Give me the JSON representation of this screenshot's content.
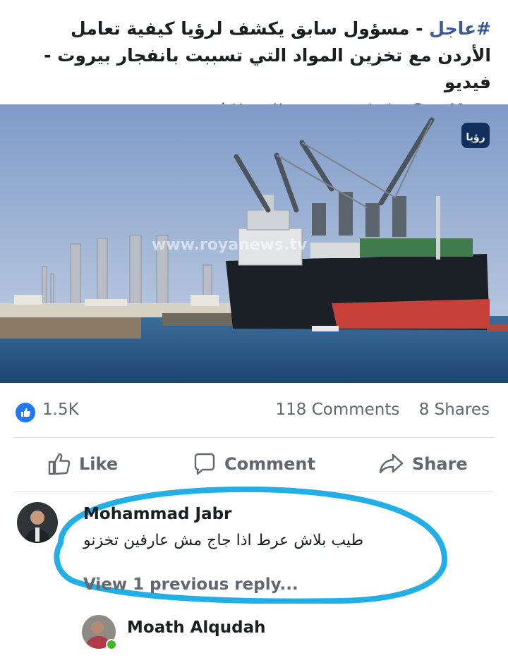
{
  "post": {
    "hashtag": "#عاجل",
    "headline_rest": " - مسؤول سابق يكشف لرؤيا كيفية تعامل الأردن مع تخزين المواد التي تسببت بانفجار بيروت - فيديو",
    "link_text": "https://royanews.tv/...",
    "see_more": "See More"
  },
  "media": {
    "watermark": "www.royanews.tv",
    "logo_text": "رؤيا"
  },
  "stats": {
    "likes": "1.5K",
    "comments": "118 Comments",
    "shares": "8 Shares"
  },
  "actions": {
    "like": "Like",
    "comment": "Comment",
    "share": "Share"
  },
  "comments": [
    {
      "author": "Mohammad Jabr",
      "text": "طيب بلاش عرط اذا جاج مش عارفين تخزنو",
      "reply_link": "View 1 previous reply..."
    },
    {
      "author": "Moath Alqudah"
    }
  ],
  "colors": {
    "link_blue": "#385898",
    "like_blue": "#2078f4",
    "highlight_circle": "#22aee6"
  }
}
